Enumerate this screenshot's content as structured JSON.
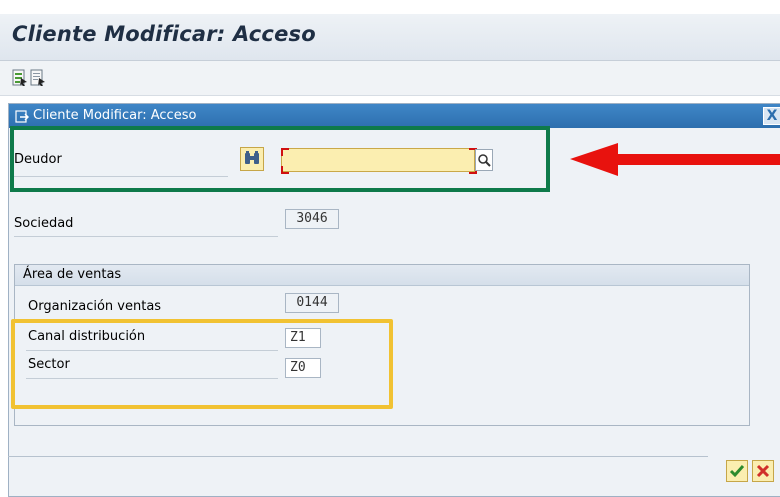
{
  "window": {
    "title": "Cliente Modificar: Acceso"
  },
  "toolbar": {
    "icons": [
      "save-variant-icon",
      "execute-icon"
    ]
  },
  "dialog": {
    "title": "Cliente Modificar: Acceso",
    "close_label": "X",
    "fields": {
      "deudor": {
        "label": "Deudor",
        "value": ""
      },
      "sociedad": {
        "label": "Sociedad",
        "value": "3046"
      }
    },
    "group": {
      "title": "Área de ventas",
      "fields": {
        "org_ventas": {
          "label": "Organización ventas",
          "value": "0144"
        },
        "canal": {
          "label": "Canal distribución",
          "value": "Z1"
        },
        "sector": {
          "label": "Sector",
          "value": "Z0"
        }
      }
    }
  },
  "colors": {
    "highlight_green": "#0e7a4a",
    "highlight_yellow": "#f1c232",
    "arrow_red": "#e8120e",
    "input_yellow": "#fbeeb0",
    "dialog_title_blue": "#2d6fae"
  }
}
